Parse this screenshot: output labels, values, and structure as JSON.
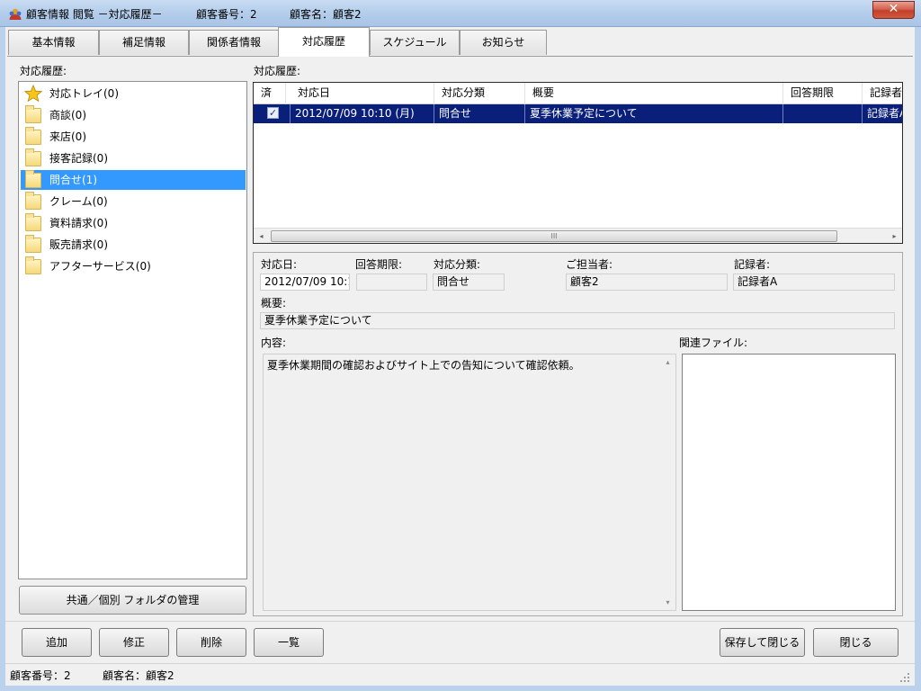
{
  "window": {
    "title": "顧客情報 閲覧 －対応履歴－",
    "customer_no": "顧客番号：2",
    "customer_name": "顧客名：顧客2",
    "close_glyph": "✕"
  },
  "tabs": [
    {
      "label": "基本情報"
    },
    {
      "label": "補足情報"
    },
    {
      "label": "関係者情報"
    },
    {
      "label": "対応履歴"
    },
    {
      "label": "スケジュール"
    },
    {
      "label": "お知らせ"
    }
  ],
  "active_tab": "対応履歴",
  "left": {
    "label": "対応履歴:",
    "tree": [
      {
        "label": "対応トレイ(0)",
        "icon": "star-icon"
      },
      {
        "label": "商談(0)",
        "icon": "folder-icon"
      },
      {
        "label": "来店(0)",
        "icon": "folder-icon"
      },
      {
        "label": "接客記録(0)",
        "icon": "folder-icon"
      },
      {
        "label": "問合せ(1)",
        "icon": "folder-open-icon",
        "selected": true
      },
      {
        "label": "クレーム(0)",
        "icon": "folder-icon"
      },
      {
        "label": "資料請求(0)",
        "icon": "folder-icon"
      },
      {
        "label": "販売請求(0)",
        "icon": "folder-icon"
      },
      {
        "label": "アフターサービス(0)",
        "icon": "folder-icon"
      }
    ],
    "manage_button": "共通／個別 フォルダの管理"
  },
  "grid": {
    "label": "対応履歴:",
    "columns": [
      "済",
      "対応日",
      "対応分類",
      "概要",
      "回答期限",
      "記録者"
    ],
    "rows": [
      {
        "done": "✓",
        "date": "2012/07/09 10:10 (月)",
        "category": "問合せ",
        "summary": "夏季休業予定について",
        "deadline": "",
        "recorder": "記録者A"
      }
    ],
    "scroll_grip": "III",
    "arrow_left": "◂",
    "arrow_right": "▸"
  },
  "detail": {
    "date_label": "対応日:",
    "date_value": "2012/07/09 10:10",
    "deadline_label": "回答期限:",
    "deadline_value": "",
    "category_label": "対応分類:",
    "category_value": "問合せ",
    "staff_label": "ご担当者:",
    "staff_value": "顧客2",
    "recorder_label": "記録者:",
    "recorder_value": "記録者A",
    "summary_label": "概要:",
    "summary_value": "夏季休業予定について",
    "content_label": "内容:",
    "content_value": "夏季休業期間の確認およびサイト上での告知について確認依頼。",
    "files_label": "関連ファイル:",
    "scroll_up": "▴",
    "scroll_down": "▾"
  },
  "buttons": {
    "add": "追加",
    "edit": "修正",
    "delete": "削除",
    "list": "一覧",
    "save_close": "保存して閉じる",
    "close": "閉じる"
  },
  "status": {
    "customer_no": "顧客番号：2",
    "customer_name": "顧客名：顧客2"
  }
}
